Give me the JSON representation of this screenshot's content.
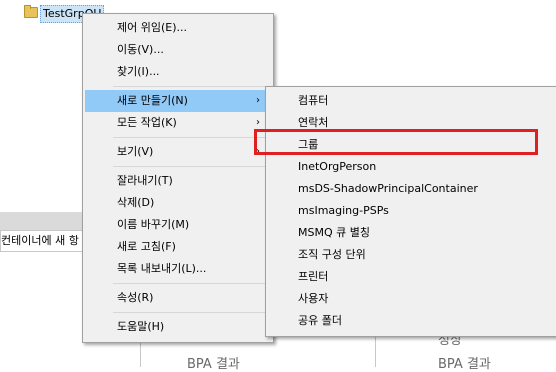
{
  "tree": {
    "node_label": "TestGrpOU"
  },
  "lower_pane": {
    "header_text": "컨테이너에 새 항",
    "label_left": "BPA 결과",
    "label_right": "BPA 결과",
    "label_right_top": "정상"
  },
  "context_menu": {
    "items": [
      {
        "label": "제어 위임(E)..."
      },
      {
        "label": "이동(V)..."
      },
      {
        "label": "찾기(I)..."
      },
      {
        "label": "새로 만들기(N)"
      },
      {
        "label": "모든 작업(K)"
      },
      {
        "label": "보기(V)"
      },
      {
        "label": "잘라내기(T)"
      },
      {
        "label": "삭제(D)"
      },
      {
        "label": "이름 바꾸기(M)"
      },
      {
        "label": "새로 고침(F)"
      },
      {
        "label": "목록 내보내기(L)..."
      },
      {
        "label": "속성(R)"
      },
      {
        "label": "도움말(H)"
      }
    ],
    "highlighted_item": "새로 만들기(N)"
  },
  "submenu": {
    "items": [
      {
        "label": "컴퓨터"
      },
      {
        "label": "연락처"
      },
      {
        "label": "그룹"
      },
      {
        "label": "InetOrgPerson"
      },
      {
        "label": "msDS-ShadowPrincipalContainer"
      },
      {
        "label": "msImaging-PSPs"
      },
      {
        "label": "MSMQ 큐 별칭"
      },
      {
        "label": "조직 구성 단위"
      },
      {
        "label": "프린터"
      },
      {
        "label": "사용자"
      },
      {
        "label": "공유 폴더"
      }
    ],
    "emphasized_item": "그룹"
  },
  "colors": {
    "menu_bg": "#f0f0f0",
    "highlight": "#91c9f7",
    "emphasis_box": "#e02020"
  }
}
